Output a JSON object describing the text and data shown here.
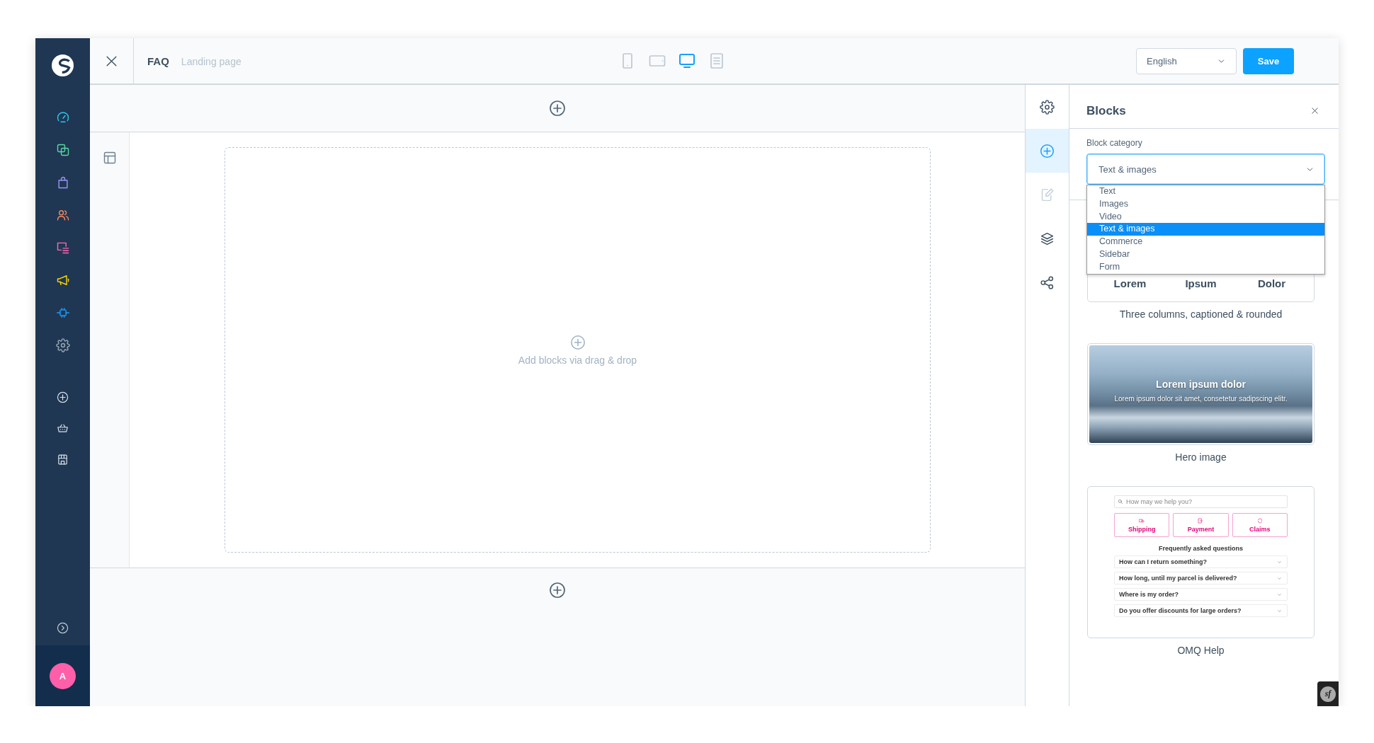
{
  "sidebar": {
    "items": [
      {
        "kind": "gauge",
        "color": "#2cc7ef"
      },
      {
        "kind": "squares",
        "color": "#57d9a3"
      },
      {
        "kind": "bag",
        "color": "#a092f0"
      },
      {
        "kind": "people",
        "color": "#f88962"
      },
      {
        "kind": "content",
        "color": "#ff68b4"
      },
      {
        "kind": "megaphone",
        "color": "#ffd700"
      },
      {
        "kind": "plug",
        "color": "#189eff"
      },
      {
        "kind": "gear",
        "color": "#9aa8b5"
      }
    ],
    "actions": [
      {
        "kind": "plus"
      },
      {
        "kind": "basket"
      },
      {
        "kind": "store"
      }
    ],
    "user": {
      "initial": "A"
    }
  },
  "topbar": {
    "title": "FAQ",
    "subtitle": "Landing page",
    "devices": [
      {
        "kind": "phone",
        "selected": false
      },
      {
        "kind": "tablet",
        "selected": false
      },
      {
        "kind": "desktop",
        "selected": true
      },
      {
        "kind": "document",
        "selected": false
      }
    ],
    "language": {
      "value": "English"
    },
    "save": "Save"
  },
  "canvas": {
    "empty_text": "Add blocks via drag & drop"
  },
  "tools": [
    {
      "kind": "gear",
      "selected": false,
      "disabled": false
    },
    {
      "kind": "plus",
      "selected": true,
      "disabled": false
    },
    {
      "kind": "edit",
      "selected": false,
      "disabled": true
    },
    {
      "kind": "layers",
      "selected": false,
      "disabled": false
    },
    {
      "kind": "share",
      "selected": false,
      "disabled": false
    }
  ],
  "panel": {
    "title": "Blocks",
    "category": {
      "label": "Block category",
      "value": "Text & images",
      "expanded": true,
      "options": [
        {
          "label": "Text",
          "selected": false
        },
        {
          "label": "Images",
          "selected": false
        },
        {
          "label": "Video",
          "selected": false
        },
        {
          "label": "Text & images",
          "selected": true
        },
        {
          "label": "Commerce",
          "selected": false
        },
        {
          "label": "Sidebar",
          "selected": false
        },
        {
          "label": "Form",
          "selected": false
        }
      ]
    },
    "blocks": [
      {
        "kind": "columns",
        "caption": "Three columns, captioned & rounded",
        "columns": [
          "Lorem",
          "Ipsum",
          "Dolor"
        ]
      },
      {
        "kind": "hero",
        "caption": "Hero image",
        "title": "Lorem ipsum dolor",
        "text": "Lorem ipsum dolor sit amet, consetetur sadipscing elitr."
      },
      {
        "kind": "help",
        "caption": "OMQ Help",
        "search": {
          "placeholder": "How may we help you?"
        },
        "tiles": [
          {
            "kind": "truck",
            "label": "Shipping"
          },
          {
            "kind": "card",
            "label": "Payment"
          },
          {
            "kind": "refresh",
            "label": "Claims"
          }
        ],
        "heading": "Frequently asked questions",
        "questions": [
          "How can I return something?",
          "How long, until my parcel is delivered?",
          "Where is my order?",
          "Do you offer discounts for large orders?"
        ]
      }
    ]
  },
  "debug_toolbar": {
    "label": "sf"
  }
}
